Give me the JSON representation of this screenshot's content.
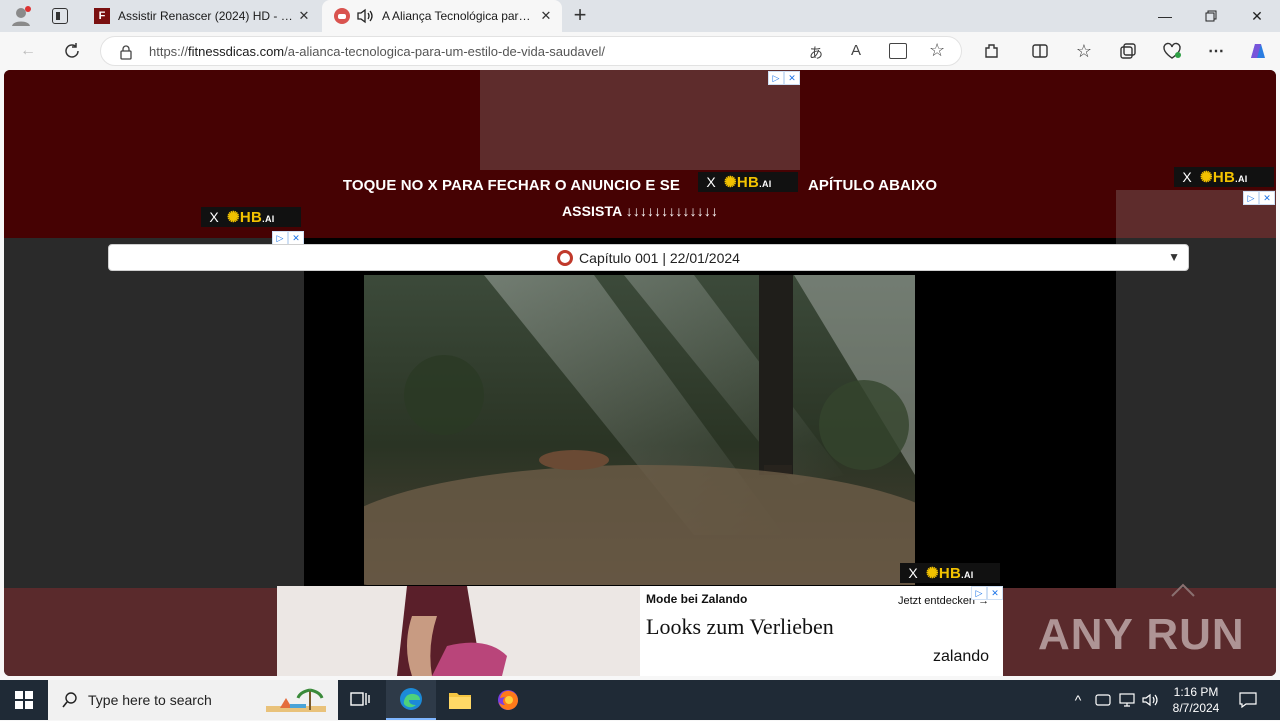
{
  "browser": {
    "tabs": [
      {
        "title": "Assistir Renascer (2024) HD - Nov",
        "active": false
      },
      {
        "title": "A Aliança Tecnológica para um",
        "active": true
      }
    ],
    "url": {
      "scheme": "https://",
      "host": "fitnessdicas.com",
      "path": "/a-alianca-tecnologica-para-um-estilo-de-vida-saudavel/"
    }
  },
  "page": {
    "banner_line1": "TOQUE NO X PARA FECHAR O ANUNCIO E SE",
    "banner_line1_end": "APÍTULO ABAIXO",
    "banner_line2": "ASSISTA ↓↓↓↓↓↓↓↓↓↓↓↓↓",
    "hb_logo": "HB",
    "hb_logo_suffix": ".AI",
    "hb_close": "X",
    "episode_select": "Capítulo 001 | 22/01/2024",
    "ad": {
      "brand_line": "Mode bei Zalando",
      "cta": "Jetzt entdecken",
      "headline": "Looks zum Verlieben",
      "logo": "zalando"
    },
    "watermark": "ANY RUN"
  },
  "taskbar": {
    "search_placeholder": "Type here to search",
    "time": "1:16 PM",
    "date": "8/7/2024"
  },
  "colors": {
    "banner_bg": "#460203",
    "ad_block": "#5e2c2c",
    "taskbar": "#1f2a36",
    "hb_yellow": "#f2c200"
  }
}
